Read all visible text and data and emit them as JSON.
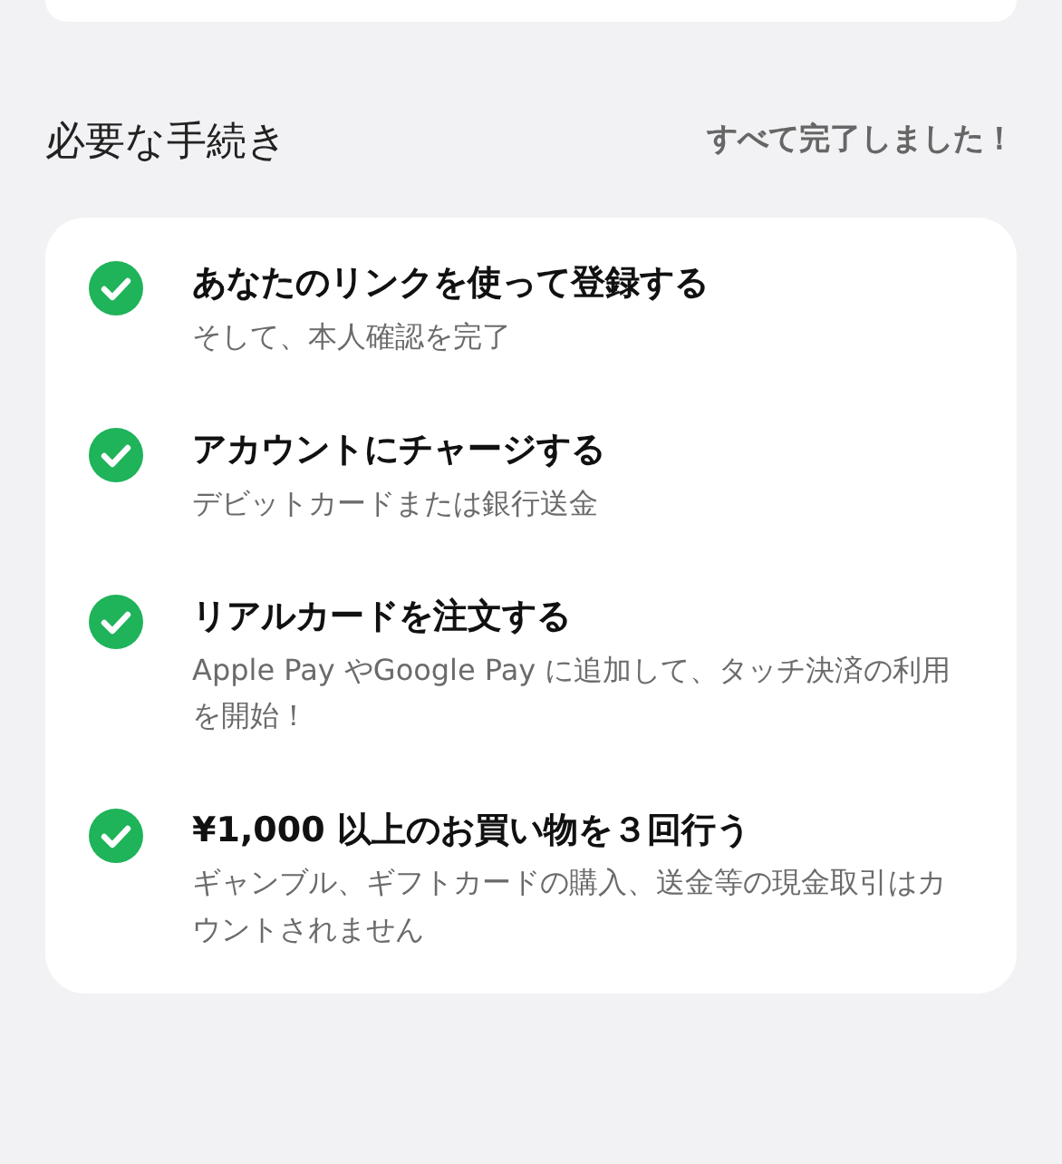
{
  "section": {
    "title": "必要な手続き",
    "status": "すべて完了しました！"
  },
  "steps": [
    {
      "title": "あなたのリンクを使って登録する",
      "subtitle": "そして、本人確認を完了",
      "done": true
    },
    {
      "title": "アカウントにチャージする",
      "subtitle": "デビットカードまたは銀行送金",
      "done": true
    },
    {
      "title": "リアルカードを注文する",
      "subtitle": "Apple Pay やGoogle Pay に追加して、タッチ決済の利用を開始！",
      "done": true
    },
    {
      "title": "¥1,000 以上のお買い物を３回行う",
      "subtitle": "ギャンブル、ギフトカードの購入、送金等の現金取引はカウントされません",
      "done": true
    }
  ]
}
